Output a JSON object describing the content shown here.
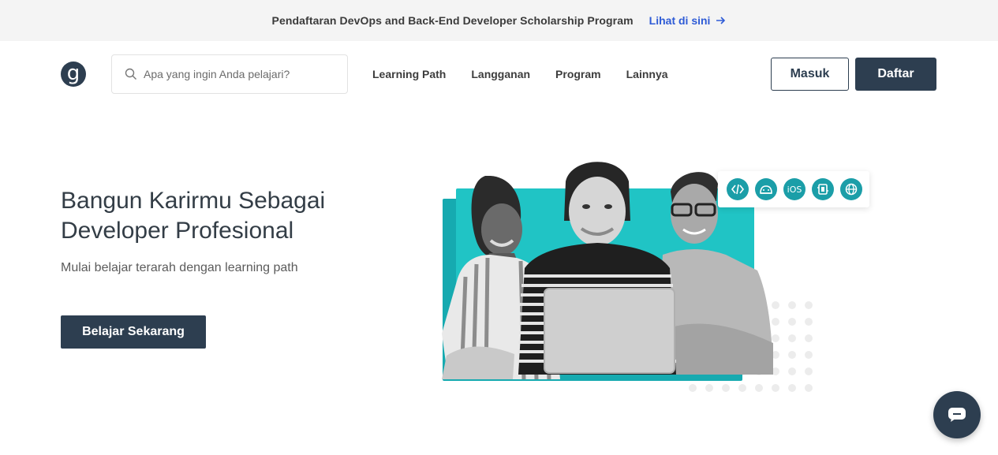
{
  "announcement": {
    "text": "Pendaftaran DevOps and Back-End Developer Scholarship Program",
    "link_label": "Lihat di sini",
    "link_icon": "arrow-right-icon"
  },
  "navbar": {
    "logo_glyph": "g",
    "search": {
      "placeholder": "Apa yang ingin Anda pelajari?",
      "value": ""
    },
    "links": [
      "Learning Path",
      "Langganan",
      "Program",
      "Lainnya"
    ],
    "login_label": "Masuk",
    "register_label": "Daftar"
  },
  "hero": {
    "title_line1": "Bangun Karirmu Sebagai",
    "title_line2": "Developer Profesional",
    "subtitle": "Mulai belajar terarah dengan learning path",
    "cta_label": "Belajar Sekarang",
    "tech_icons": [
      {
        "name": "code-icon",
        "glyph": "</>"
      },
      {
        "name": "android-icon",
        "glyph": ""
      },
      {
        "name": "ios-icon",
        "glyph": "iOS"
      },
      {
        "name": "multiplatform-icon",
        "glyph": ""
      },
      {
        "name": "web-icon",
        "glyph": ""
      }
    ]
  },
  "chat": {
    "icon": "chat-icon"
  },
  "colors": {
    "primary": "#2d3e50",
    "accent_link": "#2e5bd6",
    "teal": "#20c4c5",
    "teal_dark": "#16aab0",
    "icon_teal": "#1b9ea8"
  }
}
